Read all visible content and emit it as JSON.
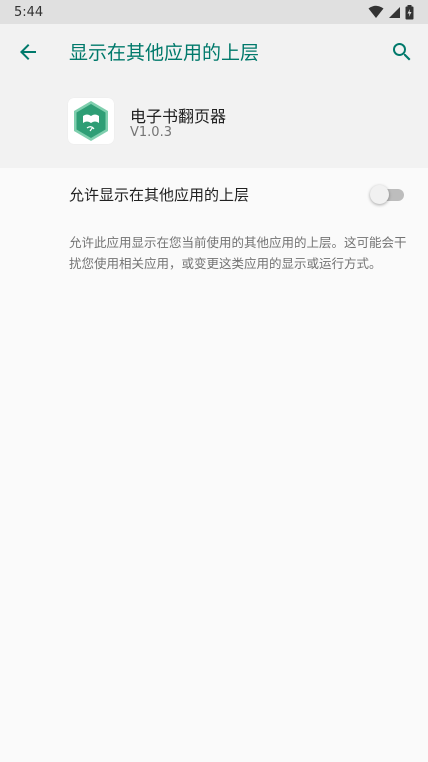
{
  "status_bar": {
    "time": "5:44",
    "icons": [
      "wifi-icon",
      "signal-icon",
      "battery-icon"
    ]
  },
  "toolbar": {
    "back_icon": "arrow-back-icon",
    "title": "显示在其他应用的上层",
    "search_icon": "search-icon"
  },
  "app": {
    "name": "电子书翻页器",
    "version": "V1.0.3"
  },
  "setting": {
    "label": "允许显示在其他应用的上层",
    "enabled": false
  },
  "description": "允许此应用显示在您当前使用的其他应用的上层。这可能会干扰您使用相关应用，或变更这类应用的显示或运行方式。",
  "colors": {
    "accent": "#00796b",
    "app_icon_green": "#2e9e75",
    "status_bar_bg": "#e0e0e0",
    "header_bg": "#f2f2f2",
    "page_bg": "#fafafa"
  }
}
